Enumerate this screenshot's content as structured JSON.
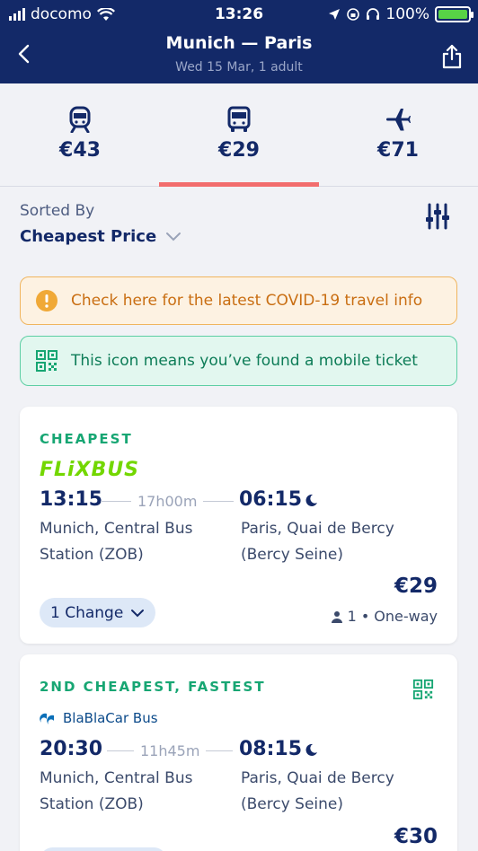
{
  "status_bar": {
    "carrier": "docomo",
    "time": "13:26",
    "battery": "100%"
  },
  "nav": {
    "title": "Munich — Paris",
    "subtitle": "Wed 15 Mar, 1 adult"
  },
  "modes": [
    {
      "name": "train",
      "icon": "train-icon",
      "price": "€43",
      "selected": false
    },
    {
      "name": "bus",
      "icon": "bus-icon",
      "price": "€29",
      "selected": true
    },
    {
      "name": "flight",
      "icon": "plane-icon",
      "price": "€71",
      "selected": false
    }
  ],
  "sort": {
    "label": "Sorted By",
    "value": "Cheapest Price"
  },
  "banners": {
    "covid": "Check here for the latest COVID-19 travel info",
    "mobile": "This icon means you’ve found a mobile ticket"
  },
  "results": [
    {
      "tag": "CHEAPEST",
      "operator": "FLiXBUS",
      "departure_time": "13:15",
      "duration": "17h00m",
      "arrival_time": "06:15",
      "departure_station": "Munich, Central Bus Station (ZOB)",
      "arrival_station": "Paris, Quai de Bercy (Bercy Seine)",
      "price": "€29",
      "changes": "1 Change",
      "passengers": "1",
      "trip_type": "One-way"
    },
    {
      "tag": "2ND CHEAPEST, FASTEST",
      "operator": "BlaBlaCar Bus",
      "departure_time": "20:30",
      "duration": "11h45m",
      "arrival_time": "08:15",
      "departure_station": "Munich, Central Bus Station (ZOB)",
      "arrival_station": "Paris, Quai de Bercy (Bercy Seine)",
      "price": "€30"
    }
  ],
  "colors": {
    "navy": "#132968",
    "accent": "#f26d6d",
    "flixbus": "#73d700",
    "green": "#17a673"
  }
}
